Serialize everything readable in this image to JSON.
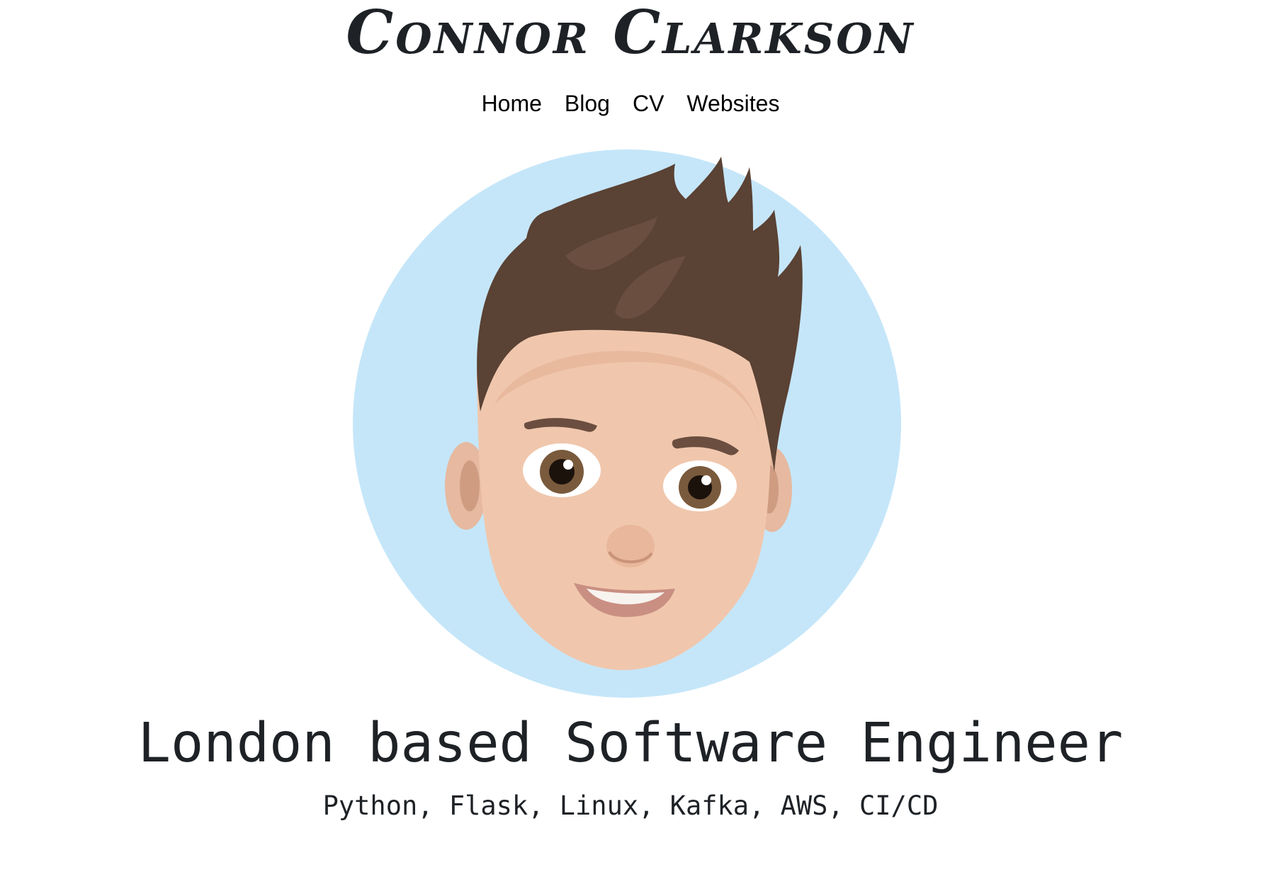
{
  "header": {
    "site_title": "Connor Clarkson"
  },
  "nav": {
    "items": [
      {
        "label": "Home"
      },
      {
        "label": "Blog"
      },
      {
        "label": "CV"
      },
      {
        "label": "Websites"
      }
    ]
  },
  "avatar": {
    "background_color": "#c5e6f9"
  },
  "hero": {
    "headline": "London based Software Engineer",
    "skills": "Python, Flask, Linux, Kafka, AWS, CI/CD"
  }
}
